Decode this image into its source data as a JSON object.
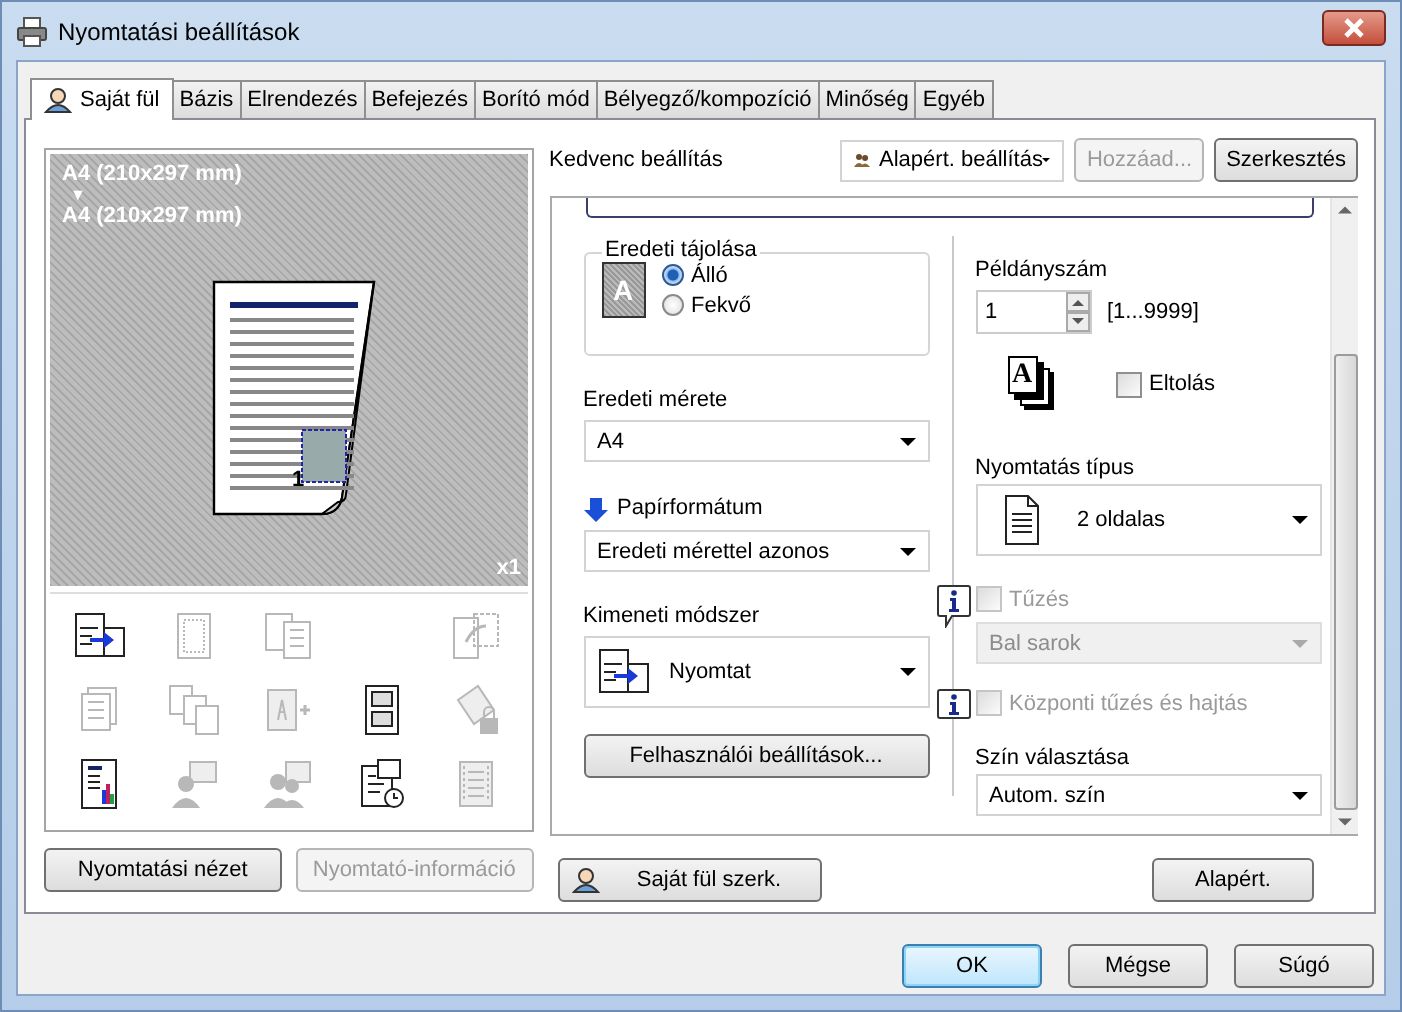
{
  "window": {
    "title": "Nyomtatási beállítások"
  },
  "tabs": [
    {
      "label": "Saját fül",
      "selected": true,
      "kind": "user"
    },
    {
      "label": "Bázis",
      "selected": false
    },
    {
      "label": "Elrendezés",
      "selected": false
    },
    {
      "label": "Befejezés",
      "selected": false
    },
    {
      "label": "Borító mód",
      "selected": false
    },
    {
      "label": "Bélyegző/kompozíció",
      "selected": false
    },
    {
      "label": "Minőség",
      "selected": false
    },
    {
      "label": "Egyéb",
      "selected": false
    }
  ],
  "preview": {
    "source_size": "A4 (210x297 mm)",
    "arrow": "▼",
    "output_size": "A4 (210x297 mm)",
    "page_number": "1",
    "copies_badge": "x1"
  },
  "function_icons": [
    [
      {
        "kind": "print-output",
        "enabled": true
      },
      {
        "kind": "dotted-page",
        "enabled": false
      },
      {
        "kind": "page-pair",
        "enabled": false
      },
      {
        "kind": "booklet",
        "enabled": false
      }
    ],
    [
      {
        "kind": "page-stack",
        "enabled": false
      },
      {
        "kind": "multi-page",
        "enabled": false
      },
      {
        "kind": "insert-page",
        "enabled": false
      },
      {
        "kind": "form-page",
        "enabled": true
      },
      {
        "kind": "locked-page",
        "enabled": false
      }
    ],
    [
      {
        "kind": "chart-page",
        "enabled": true
      },
      {
        "kind": "user-page",
        "enabled": false
      },
      {
        "kind": "users-page",
        "enabled": false
      },
      {
        "kind": "clock-page",
        "enabled": true
      },
      {
        "kind": "film-page",
        "enabled": false
      }
    ]
  ],
  "preview_buttons": [
    {
      "label": "Nyomtatási nézet",
      "disabled": false
    },
    {
      "label": "Nyomtató-információ",
      "disabled": true
    }
  ],
  "favorite": {
    "label": "Kedvenc beállítás",
    "value": "Alapért. beállítás",
    "buttons": [
      {
        "label": "Hozzáad...",
        "disabled": true
      },
      {
        "label": "Szerkesztés",
        "disabled": false
      }
    ]
  },
  "orientation": {
    "label": "Eredeti tájolása",
    "icon_letter": "A",
    "options": [
      {
        "label": "Álló",
        "selected": true
      },
      {
        "label": "Fekvő",
        "selected": false
      }
    ]
  },
  "original_size": {
    "label": "Eredeti mérete",
    "value": "A4"
  },
  "paper_size": {
    "label": "Papírformátum",
    "value": "Eredeti mérettel azonos"
  },
  "output_method": {
    "label": "Kimeneti módszer",
    "value": "Nyomtat"
  },
  "user_settings_button": "Felhasználói beállítások...",
  "copies": {
    "label": "Példányszám",
    "value": "1",
    "range": "[1...9999]",
    "stack_letter": "A"
  },
  "offset": {
    "label": "Eltolás",
    "checked": false
  },
  "print_type": {
    "label": "Nyomtatás típus",
    "value": "2 oldalas"
  },
  "stapling": {
    "label": "Tűzés",
    "checked": false,
    "disabled": true,
    "position": "Bal sarok"
  },
  "center_staple": {
    "label": "Központi tűzés és hajtás",
    "checked": false,
    "disabled": true
  },
  "color": {
    "label": "Szín választása",
    "value": "Autom. szín"
  },
  "my_tab_edit_button": "Saját fül szerk.",
  "default_button": "Alapért.",
  "dialog_buttons": [
    {
      "label": "OK",
      "default": true
    },
    {
      "label": "Mégse",
      "default": false
    },
    {
      "label": "Súgó",
      "default": false
    }
  ]
}
